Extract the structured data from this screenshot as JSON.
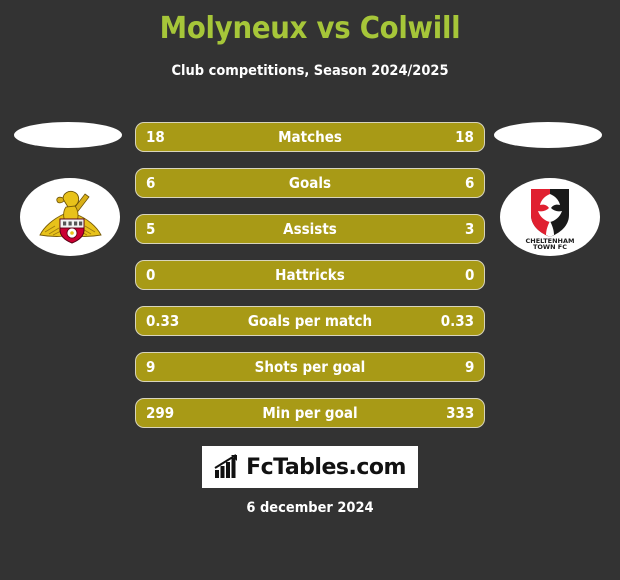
{
  "header": {
    "title": "Molyneux vs Colwill",
    "subtitle": "Club competitions, Season 2024/2025",
    "title_color": "#a6c639",
    "subtitle_color": "#ffffff"
  },
  "background_color": "#333333",
  "bar_color": "#a89a16",
  "teams": {
    "home": {
      "crest_name": "doncaster-rovers-crest",
      "crest_colors": [
        "#e8c21a",
        "#d4a017",
        "#cc0033",
        "#ffffff"
      ]
    },
    "away": {
      "crest_name": "cheltenham-town-crest",
      "crest_label_line1": "CHELTENHAM",
      "crest_label_line2": "TOWN FC",
      "crest_colors": [
        "#e02030",
        "#1a1a1a",
        "#ffffff"
      ]
    }
  },
  "stats": [
    {
      "label": "Matches",
      "home": "18",
      "away": "18"
    },
    {
      "label": "Goals",
      "home": "6",
      "away": "6"
    },
    {
      "label": "Assists",
      "home": "5",
      "away": "3"
    },
    {
      "label": "Hattricks",
      "home": "0",
      "away": "0"
    },
    {
      "label": "Goals per match",
      "home": "0.33",
      "away": "0.33"
    },
    {
      "label": "Shots per goal",
      "home": "9",
      "away": "9"
    },
    {
      "label": "Min per goal",
      "home": "299",
      "away": "333"
    }
  ],
  "footer": {
    "brand_text": "FcTables.com",
    "brand_icon": "bar-chart-growth-icon",
    "date": "6 december 2024"
  }
}
